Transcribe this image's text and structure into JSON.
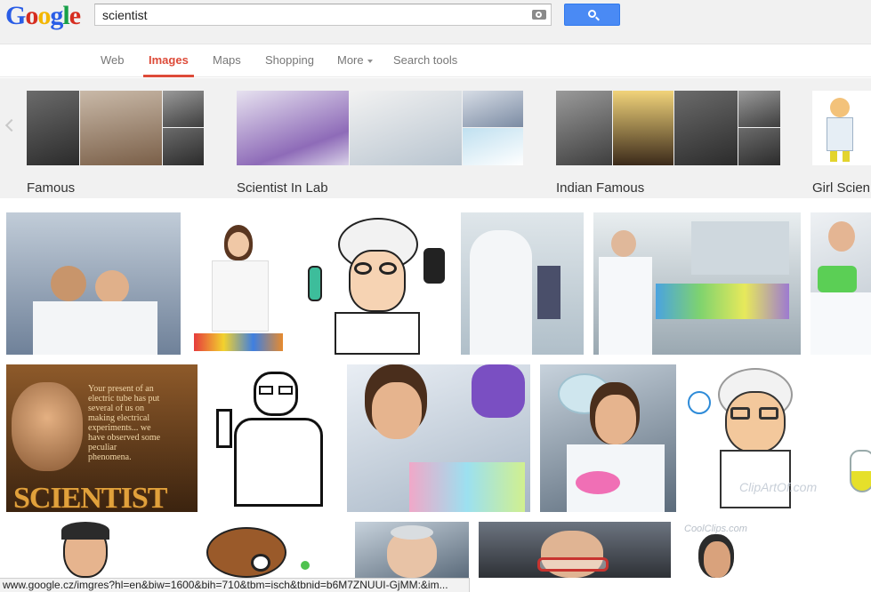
{
  "header": {
    "logo": [
      "G",
      "o",
      "o",
      "g",
      "l",
      "e"
    ],
    "search": {
      "value": "scientist",
      "placeholder": ""
    }
  },
  "tabs": [
    {
      "label": "Web",
      "active": false
    },
    {
      "label": "Images",
      "active": true
    },
    {
      "label": "Maps",
      "active": false
    },
    {
      "label": "Shopping",
      "active": false
    },
    {
      "label": "More",
      "active": false,
      "dropdown": true
    },
    {
      "label": "Search tools",
      "active": false
    }
  ],
  "related": [
    {
      "label": "Famous"
    },
    {
      "label": "Scientist In Lab"
    },
    {
      "label": "Indian Famous"
    },
    {
      "label": "Girl Scien"
    }
  ],
  "results": {
    "franklin_caption": "Your present of an electric tube has put several of us on making electrical experiments... we have observed some peculiar phenomena.",
    "franklin_word": "SCIENTIST",
    "watermark": "ClipArtOf.com",
    "watermark2": "CoolClips.com"
  },
  "status_url": "www.google.cz/imgres?hl=en&biw=1600&bih=710&tbm=isch&tbnid=b6M7ZNUUI-GjMM:&im...",
  "colors": {
    "accent": "#dd4b39",
    "search_button": "#4a8af4"
  }
}
